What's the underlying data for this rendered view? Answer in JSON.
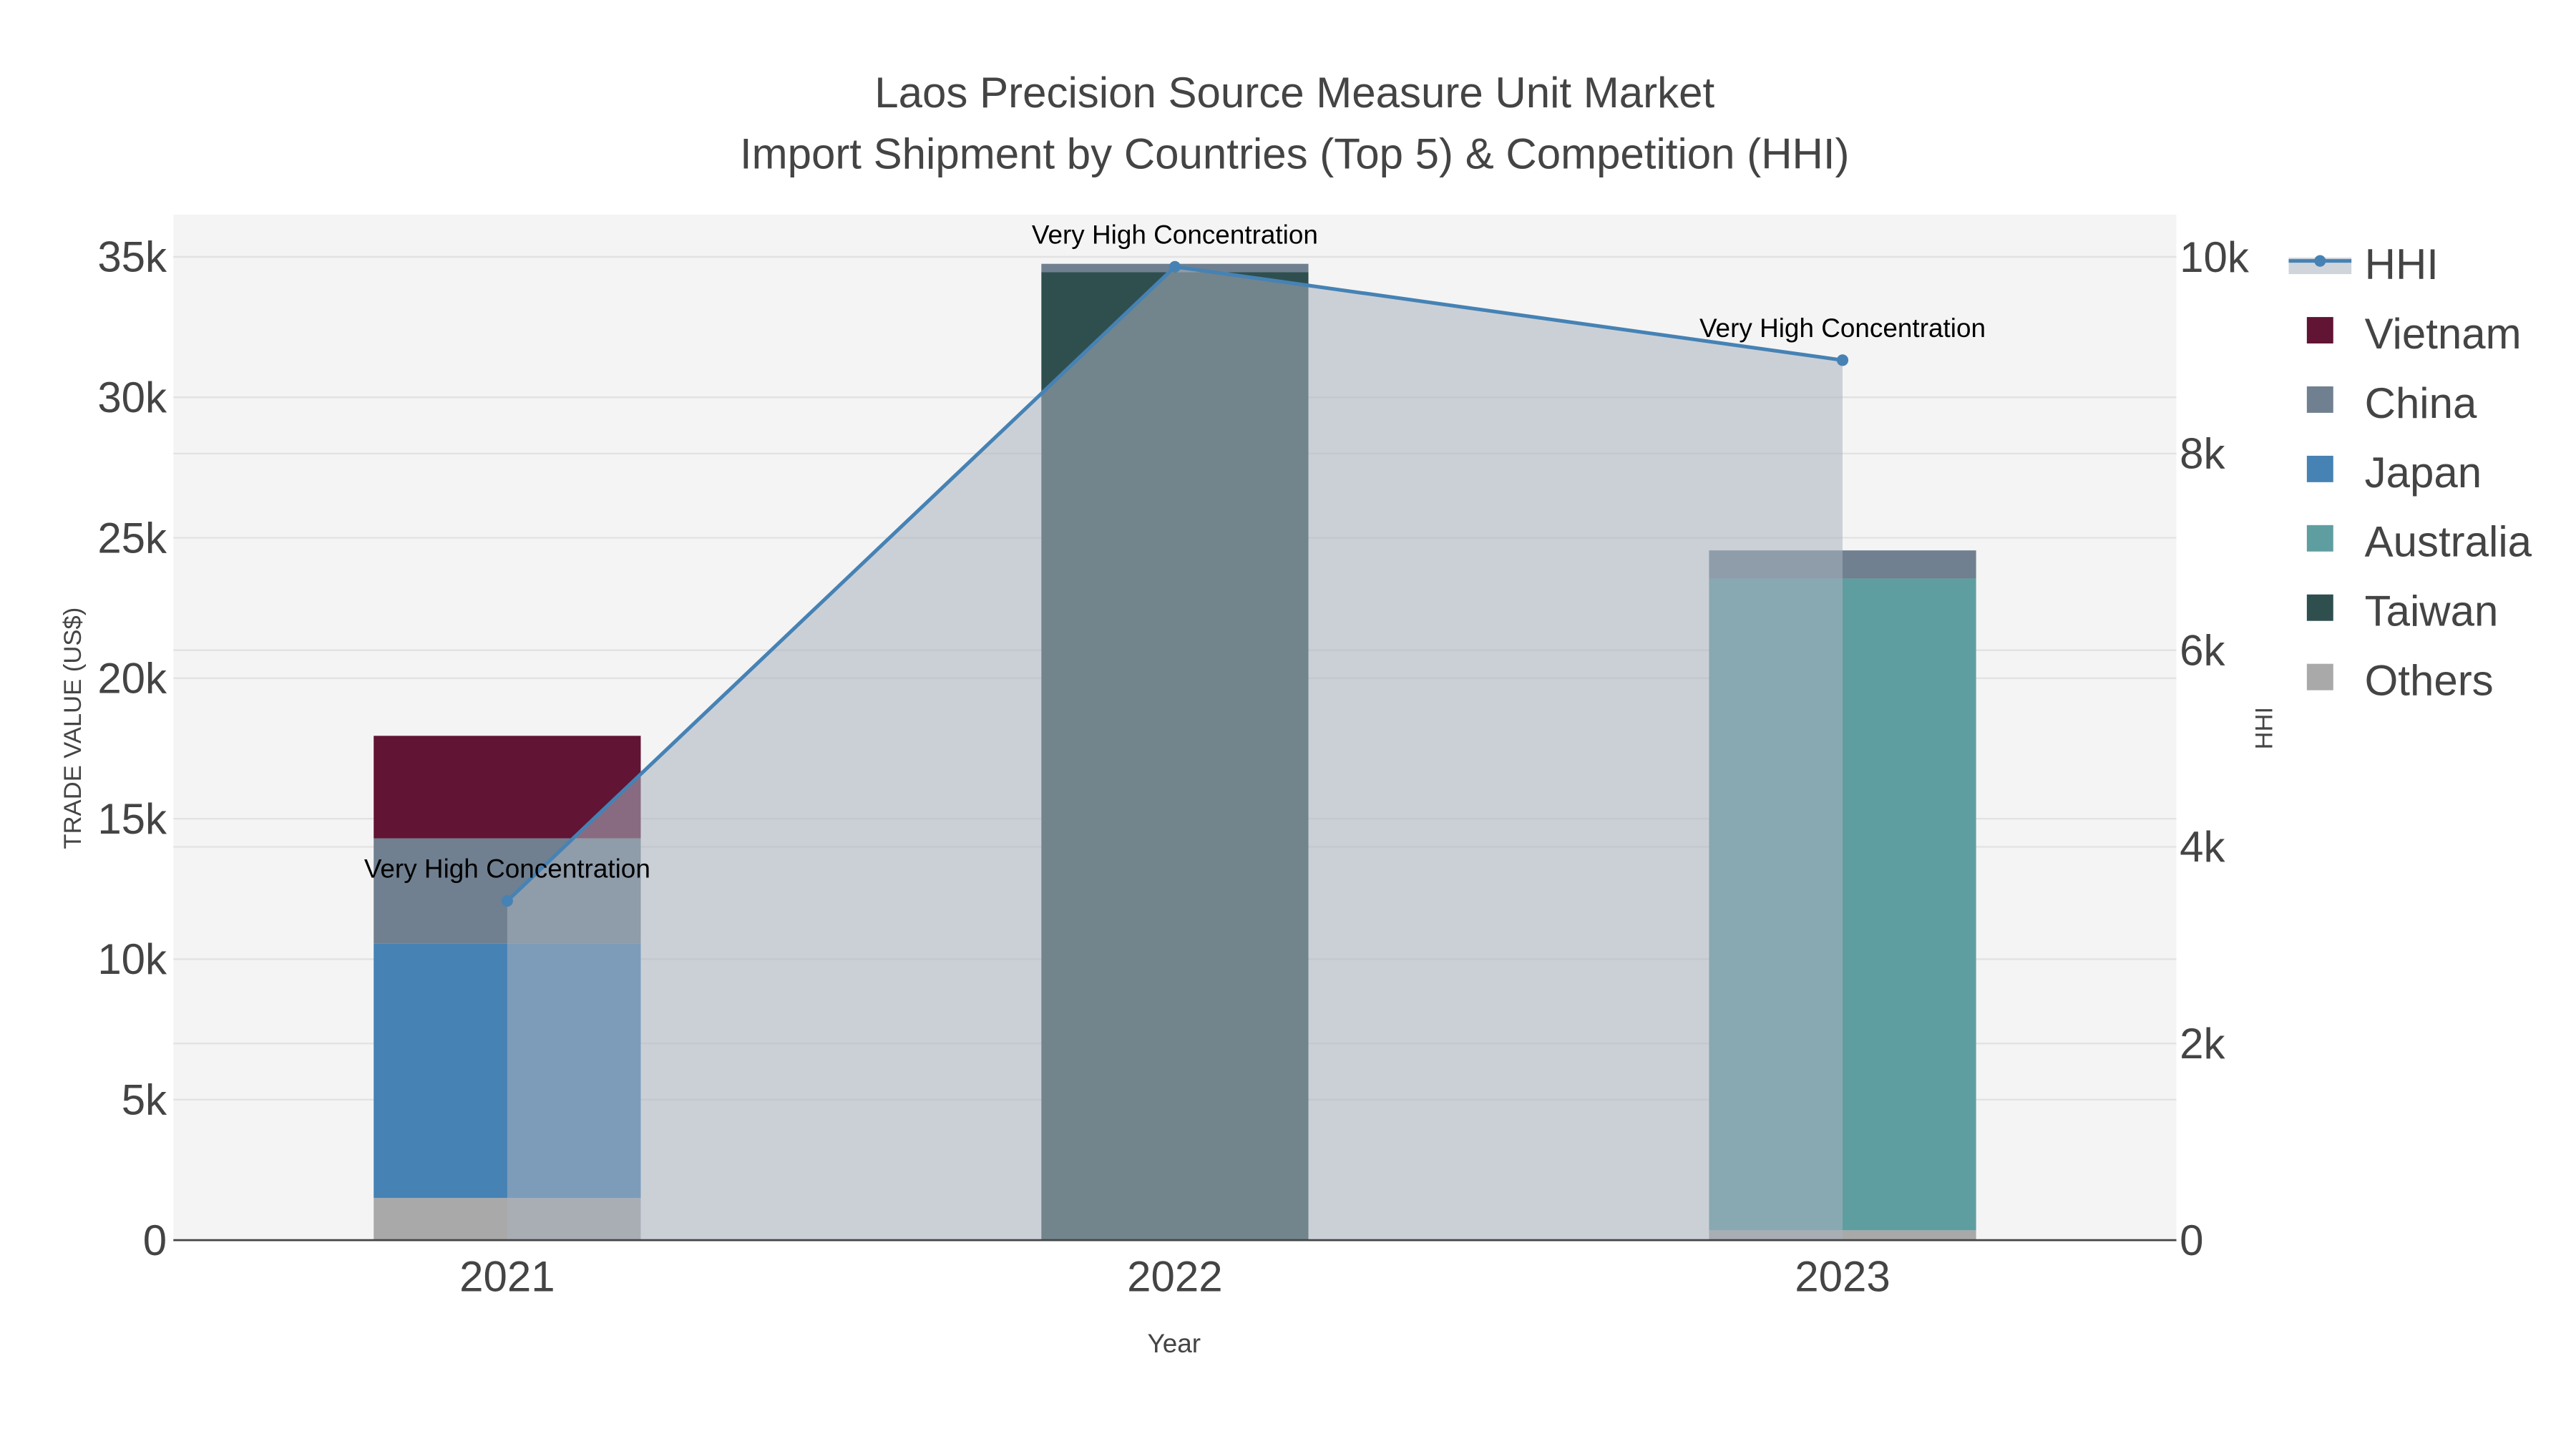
{
  "chart_data": {
    "type": "bar",
    "title_line1": "Laos Precision Source Measure Unit Market",
    "title_line2": "Import Shipment by Countries (Top 5) & Competition (HHI)",
    "xlabel": "Year",
    "ylabel": "TRADE VALUE (US$)",
    "y2label": "HHI",
    "categories": [
      "2021",
      "2022",
      "2023"
    ],
    "ylim": [
      0,
      36500
    ],
    "y2lim": [
      0,
      10430
    ],
    "yticks": [
      0,
      5000,
      10000,
      15000,
      20000,
      25000,
      30000,
      35000
    ],
    "ytick_labels": [
      "0",
      "5k",
      "10k",
      "15k",
      "20k",
      "25k",
      "30k",
      "35k"
    ],
    "y2ticks": [
      0,
      2000,
      4000,
      6000,
      8000,
      10000
    ],
    "y2tick_labels": [
      "0",
      "2k",
      "4k",
      "6k",
      "8k",
      "10k"
    ],
    "stacked": true,
    "series": [
      {
        "name": "Others",
        "color": "#A9A9A9",
        "values": [
          1500,
          0,
          350
        ]
      },
      {
        "name": "Japan",
        "color": "#4682B4",
        "values": [
          9050,
          0,
          0
        ]
      },
      {
        "name": "Australia",
        "color": "#5F9EA0",
        "values": [
          0,
          0,
          23200
        ]
      },
      {
        "name": "Taiwan",
        "color": "#2F4F4F",
        "values": [
          0,
          34450,
          0
        ]
      },
      {
        "name": "China",
        "color": "#708090",
        "values": [
          3750,
          300,
          1000
        ]
      },
      {
        "name": "Vietnam",
        "color": "#611434",
        "values": [
          3650,
          0,
          0
        ]
      }
    ],
    "hhi": {
      "name": "HHI",
      "color": "#4682B4",
      "values": [
        3450,
        9900,
        8950
      ]
    },
    "annotations": [
      "Very High Concentration",
      "Very High Concentration",
      "Very High Concentration"
    ],
    "legend": [
      "HHI",
      "Vietnam",
      "China",
      "Japan",
      "Australia",
      "Taiwan",
      "Others"
    ],
    "legend_placement": "right",
    "grid": true
  }
}
